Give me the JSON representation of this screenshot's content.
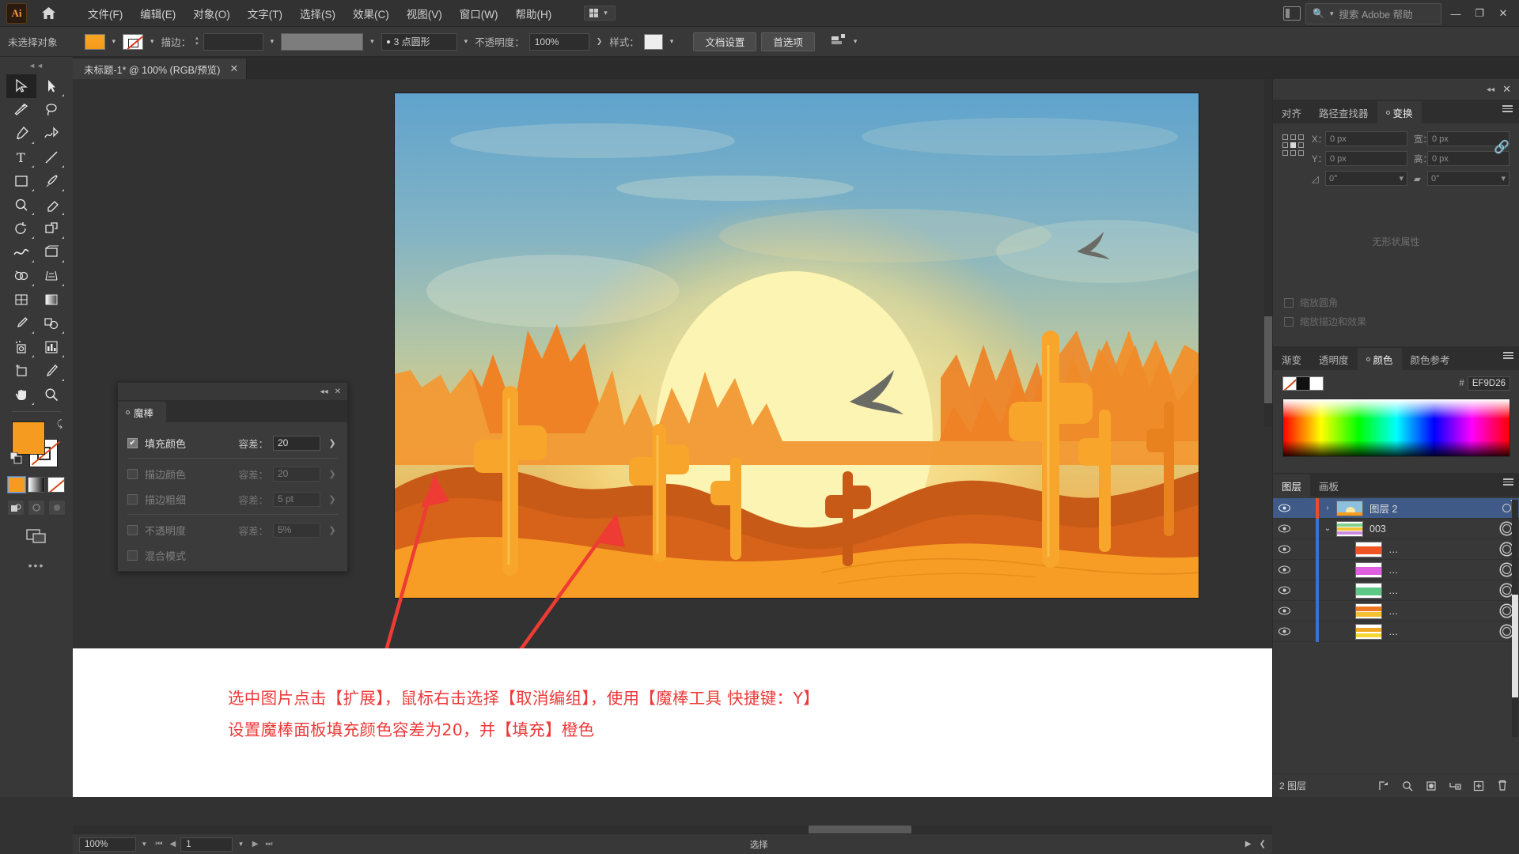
{
  "app": {
    "name": "Adobe Illustrator",
    "logo_text": "Ai"
  },
  "menubar": {
    "items": [
      {
        "label": "文件(F)"
      },
      {
        "label": "编辑(E)"
      },
      {
        "label": "对象(O)"
      },
      {
        "label": "文字(T)"
      },
      {
        "label": "选择(S)"
      },
      {
        "label": "效果(C)"
      },
      {
        "label": "视图(V)"
      },
      {
        "label": "窗口(W)"
      },
      {
        "label": "帮助(H)"
      }
    ],
    "search_placeholder": "搜索 Adobe 帮助",
    "minimize": "—",
    "restore": "❐",
    "close": "✕"
  },
  "controlbar": {
    "selection_status": "未选择对象",
    "stroke_label": "描边：",
    "stroke_weight": "",
    "stroke_profile": "3 点圆形",
    "opacity_label": "不透明度：",
    "opacity_value": "100%",
    "style_label": "样式：",
    "document_setup": "文档设置",
    "preferences": "首选项"
  },
  "document_tab": {
    "title": "未标题-1* @ 100% (RGB/预览)",
    "close": "✕"
  },
  "wand_panel": {
    "tab_label": "魔棒",
    "close": "✕",
    "rows": [
      {
        "label": "填充颜色",
        "checked": true,
        "tolerance_label": "容差：",
        "tolerance_value": "20",
        "dim": false
      },
      {
        "label": "描边颜色",
        "checked": false,
        "tolerance_label": "容差：",
        "tolerance_value": "20",
        "dim": true
      },
      {
        "label": "描边粗细",
        "checked": false,
        "tolerance_label": "容差：",
        "tolerance_value": "5 pt",
        "dim": true
      },
      {
        "label": "不透明度",
        "checked": false,
        "tolerance_label": "容差：",
        "tolerance_value": "5%",
        "dim": true
      },
      {
        "label": "混合模式",
        "checked": false,
        "tolerance_label": "",
        "tolerance_value": "",
        "dim": true
      }
    ]
  },
  "transform_panel": {
    "tabs": [
      {
        "label": "对齐",
        "active": false
      },
      {
        "label": "路径查找器",
        "active": false
      },
      {
        "label": "变换",
        "active": true
      }
    ],
    "x_label": "X：",
    "x_value": "0 px",
    "y_label": "Y：",
    "y_value": "0 px",
    "w_label": "宽：",
    "w_value": "0 px",
    "h_label": "高：",
    "h_value": "0 px",
    "angle_value": "0°",
    "shear_value": "0°",
    "checkbox_scale_corners": "缩放圆角",
    "checkbox_scale_strokes": "缩放描边和效果",
    "empty_note": "无形状属性"
  },
  "color_panel": {
    "tabs": [
      {
        "label": "渐变",
        "active": false
      },
      {
        "label": "透明度",
        "active": false
      },
      {
        "label": "颜色",
        "active": true
      },
      {
        "label": "颜色参考",
        "active": false
      }
    ],
    "hash": "#",
    "hex_value": "EF9D26",
    "fill_color": "#EF9D26"
  },
  "layers_panel": {
    "tabs": [
      {
        "label": "图层",
        "active": true
      },
      {
        "label": "画板",
        "active": false
      }
    ],
    "rows": [
      {
        "name": "图层 2",
        "selected": true,
        "indent": 0,
        "color": "#ee4b2b",
        "expander": "›",
        "thumb": "sunset",
        "double_circle": false
      },
      {
        "name": "003",
        "selected": false,
        "indent": 1,
        "color": "#3a6fd8",
        "expander": "⌄",
        "thumb": "stripes",
        "double_circle": true
      },
      {
        "name": "…",
        "selected": false,
        "indent": 2,
        "color": "#3a6fd8",
        "expander": "",
        "thumb": "red",
        "double_circle": true
      },
      {
        "name": "…",
        "selected": false,
        "indent": 2,
        "color": "#3a6fd8",
        "expander": "",
        "thumb": "magenta",
        "double_circle": true
      },
      {
        "name": "…",
        "selected": false,
        "indent": 2,
        "color": "#3a6fd8",
        "expander": "",
        "thumb": "green",
        "double_circle": true
      },
      {
        "name": "…",
        "selected": false,
        "indent": 2,
        "color": "#3a6fd8",
        "expander": "",
        "thumb": "orange",
        "double_circle": true
      },
      {
        "name": "…",
        "selected": false,
        "indent": 2,
        "color": "#3a6fd8",
        "expander": "",
        "thumb": "yellow",
        "double_circle": true
      }
    ],
    "footer_count": "2 图层"
  },
  "statusbar": {
    "zoom_value": "100%",
    "page_value": "1",
    "mode_label": "选择"
  },
  "notes": {
    "line1": "选中图片点击【扩展】，鼠标右击选择【取消编组】，使用【魔棒工具 快捷键：Y】",
    "line2": "设置魔棒面板填充颜色容差为20，并【填充】橙色",
    "color": "#ED3A3A"
  },
  "artwork": {
    "description": "沙漠日落插画：太阳、仙人掌、岩山、飞鸟",
    "sky_top": "#63A7CE",
    "sky_mid": "#9DC1B6",
    "sun_color": "#FBF3B0",
    "sand_color": "#F79D25",
    "dark_dune": "#C75A16",
    "rock_color": "#F08A2A"
  },
  "toolbar": {
    "fill_swatch": "#F59C20",
    "stroke_swatch": "none",
    "tools": [
      {
        "name": "selection-tool",
        "active": true
      },
      {
        "name": "direct-selection-tool",
        "active": false
      },
      {
        "name": "magic-wand-tool",
        "active": false
      },
      {
        "name": "lasso-tool",
        "active": false
      },
      {
        "name": "pen-tool",
        "active": false
      },
      {
        "name": "curvature-tool",
        "active": false
      },
      {
        "name": "type-tool",
        "active": false
      },
      {
        "name": "line-segment-tool",
        "active": false
      },
      {
        "name": "rectangle-tool",
        "active": false
      },
      {
        "name": "paintbrush-tool",
        "active": false
      },
      {
        "name": "shaper-tool",
        "active": false
      },
      {
        "name": "eraser-tool",
        "active": false
      },
      {
        "name": "rotate-tool",
        "active": false
      },
      {
        "name": "scale-tool",
        "active": false
      },
      {
        "name": "width-tool",
        "active": false
      },
      {
        "name": "free-transform-tool",
        "active": false
      },
      {
        "name": "shape-builder-tool",
        "active": false
      },
      {
        "name": "perspective-grid-tool",
        "active": false
      },
      {
        "name": "mesh-tool",
        "active": false
      },
      {
        "name": "gradient-tool",
        "active": false
      },
      {
        "name": "eyedropper-tool",
        "active": false
      },
      {
        "name": "blend-tool",
        "active": false
      },
      {
        "name": "symbol-sprayer-tool",
        "active": false
      },
      {
        "name": "column-graph-tool",
        "active": false
      },
      {
        "name": "artboard-tool",
        "active": false
      },
      {
        "name": "slice-tool",
        "active": false
      },
      {
        "name": "hand-tool",
        "active": false
      },
      {
        "name": "zoom-tool",
        "active": false
      }
    ]
  }
}
